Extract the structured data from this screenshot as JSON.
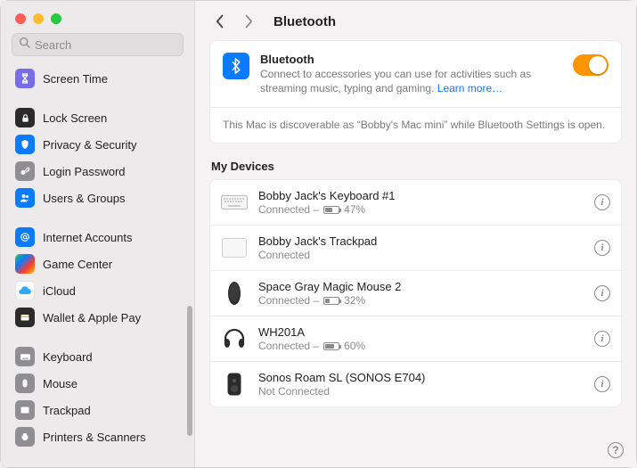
{
  "search": {
    "placeholder": "Search"
  },
  "header": {
    "title": "Bluetooth"
  },
  "sidebar": {
    "groups": [
      {
        "items": [
          {
            "label": "Screen Time"
          }
        ]
      },
      {
        "items": [
          {
            "label": "Lock Screen"
          },
          {
            "label": "Privacy & Security"
          },
          {
            "label": "Login Password"
          },
          {
            "label": "Users & Groups"
          }
        ]
      },
      {
        "items": [
          {
            "label": "Internet Accounts"
          },
          {
            "label": "Game Center"
          },
          {
            "label": "iCloud"
          },
          {
            "label": "Wallet & Apple Pay"
          }
        ]
      },
      {
        "items": [
          {
            "label": "Keyboard"
          },
          {
            "label": "Mouse"
          },
          {
            "label": "Trackpad"
          },
          {
            "label": "Printers & Scanners"
          }
        ]
      }
    ]
  },
  "bluetooth": {
    "title": "Bluetooth",
    "description": "Connect to accessories you can use for activities such as streaming music, typing and gaming. ",
    "learn_more": "Learn more…",
    "enabled": true,
    "discoverable": "This Mac is discoverable as “Bobby's Mac mini” while Bluetooth Settings is open."
  },
  "devices": {
    "heading": "My Devices",
    "list": [
      {
        "name": "Bobby Jack's Keyboard #1",
        "status_prefix": "Connected – ",
        "battery": 47,
        "battery_text": "47%",
        "icon": "keyboard"
      },
      {
        "name": "Bobby Jack's Trackpad",
        "status_prefix": "Connected",
        "battery": null,
        "battery_text": "",
        "icon": "trackpad"
      },
      {
        "name": "Space Gray Magic Mouse 2",
        "status_prefix": "Connected – ",
        "battery": 32,
        "battery_text": "32%",
        "icon": "mouse"
      },
      {
        "name": "WH201A",
        "status_prefix": "Connected – ",
        "battery": 60,
        "battery_text": "60%",
        "icon": "headphones"
      },
      {
        "name": "Sonos Roam SL (SONOS E704)",
        "status_prefix": "Not Connected",
        "battery": null,
        "battery_text": "",
        "icon": "speaker"
      }
    ]
  }
}
